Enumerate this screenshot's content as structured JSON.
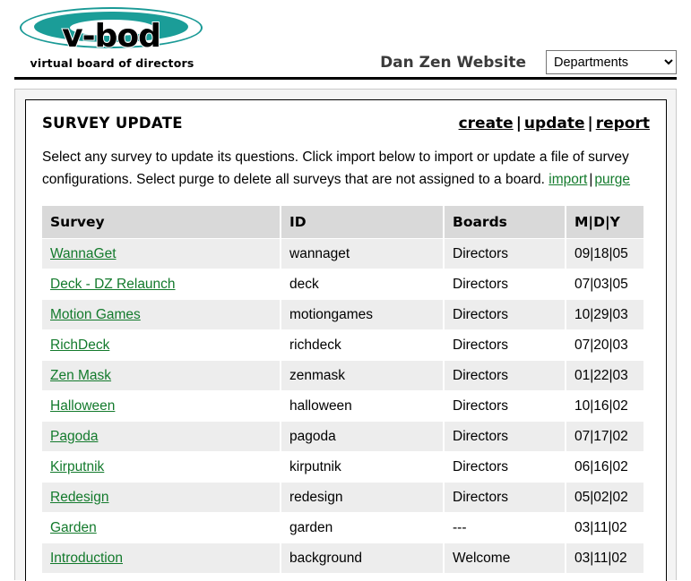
{
  "header": {
    "logo_word": "v-bod",
    "logo_tagline": "virtual board of directors",
    "site_name": "Dan Zen Website",
    "dropdown": {
      "selected": "Departments",
      "options": [
        "Departments"
      ]
    }
  },
  "page": {
    "title": "SURVEY UPDATE",
    "actions": [
      {
        "label": "create"
      },
      {
        "label": "update"
      },
      {
        "label": "report"
      }
    ],
    "action_separator": "|",
    "description": {
      "text": "Select any survey to update its questions. Click import below to import or update a file of survey configurations. Select purge to delete all surveys that are not assigned to a board.",
      "import_label": "import",
      "purge_label": "purge",
      "separator": "|"
    }
  },
  "table": {
    "columns": [
      "Survey",
      "ID",
      "Boards",
      "M|D|Y"
    ],
    "rows": [
      {
        "survey": "WannaGet",
        "id": "wannaget",
        "boards": "Directors",
        "date": "09|18|05"
      },
      {
        "survey": "Deck - DZ Relaunch",
        "id": "deck",
        "boards": "Directors",
        "date": "07|03|05"
      },
      {
        "survey": "Motion Games",
        "id": "motiongames",
        "boards": "Directors",
        "date": "10|29|03"
      },
      {
        "survey": "RichDeck",
        "id": "richdeck",
        "boards": "Directors",
        "date": "07|20|03"
      },
      {
        "survey": "Zen Mask",
        "id": "zenmask",
        "boards": "Directors",
        "date": "01|22|03"
      },
      {
        "survey": "Halloween",
        "id": "halloween",
        "boards": "Directors",
        "date": "10|16|02"
      },
      {
        "survey": "Pagoda",
        "id": "pagoda",
        "boards": "Directors",
        "date": "07|17|02"
      },
      {
        "survey": "Kirputnik",
        "id": "kirputnik",
        "boards": "Directors",
        "date": "06|16|02"
      },
      {
        "survey": "Redesign",
        "id": "redesign",
        "boards": "Directors",
        "date": "05|02|02"
      },
      {
        "survey": "Garden",
        "id": "garden",
        "boards": "---",
        "date": "03|11|02"
      },
      {
        "survey": "Introduction",
        "id": "background",
        "boards": "Welcome",
        "date": "03|11|02"
      }
    ]
  },
  "colors": {
    "logo_teal": "#1b9d98",
    "link_green": "#137a2c",
    "header_row_gray": "#d9d9d9",
    "band_gray": "#ededed",
    "site_name_gray": "#3b3b3b"
  }
}
